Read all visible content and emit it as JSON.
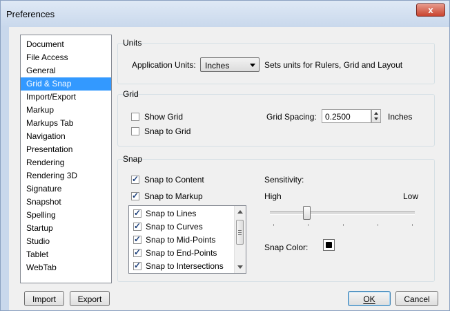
{
  "window": {
    "title": "Preferences",
    "close_glyph": "x"
  },
  "categories": {
    "items": [
      "Document",
      "File Access",
      "General",
      "Grid & Snap",
      "Import/Export",
      "Markup",
      "Markups Tab",
      "Navigation",
      "Presentation",
      "Rendering",
      "Rendering 3D",
      "Signature",
      "Snapshot",
      "Spelling",
      "Startup",
      "Studio",
      "Tablet",
      "WebTab"
    ],
    "selected": "Grid & Snap"
  },
  "units": {
    "section_label": "Units",
    "app_units_label": "Application Units:",
    "app_units_value": "Inches",
    "app_units_note": "Sets units for Rulers, Grid and Layout"
  },
  "grid": {
    "section_label": "Grid",
    "show_grid_label": "Show Grid",
    "show_grid_checked": false,
    "snap_to_grid_label": "Snap to Grid",
    "snap_to_grid_checked": false,
    "spacing_label": "Grid Spacing:",
    "spacing_value": "0.2500",
    "spacing_unit": "Inches"
  },
  "snap": {
    "section_label": "Snap",
    "snap_to_content_label": "Snap to Content",
    "snap_to_content_checked": true,
    "snap_to_markup_label": "Snap to Markup",
    "snap_to_markup_checked": true,
    "options": [
      {
        "label": "Snap to Lines",
        "checked": true
      },
      {
        "label": "Snap to Curves",
        "checked": true
      },
      {
        "label": "Snap to Mid-Points",
        "checked": true
      },
      {
        "label": "Snap to End-Points",
        "checked": true
      },
      {
        "label": "Snap to Intersections",
        "checked": true
      }
    ],
    "sensitivity_label": "Sensitivity:",
    "sensitivity_high": "High",
    "sensitivity_low": "Low",
    "sensitivity_value": 0.25,
    "snap_color_label": "Snap Color:",
    "snap_color": "#000000"
  },
  "buttons": {
    "import": "Import",
    "export": "Export",
    "ok": "OK",
    "cancel": "Cancel"
  },
  "colors": {
    "selection": "#3399ff",
    "titlebar": "#c9d8ec",
    "close_button": "#c9442f"
  }
}
